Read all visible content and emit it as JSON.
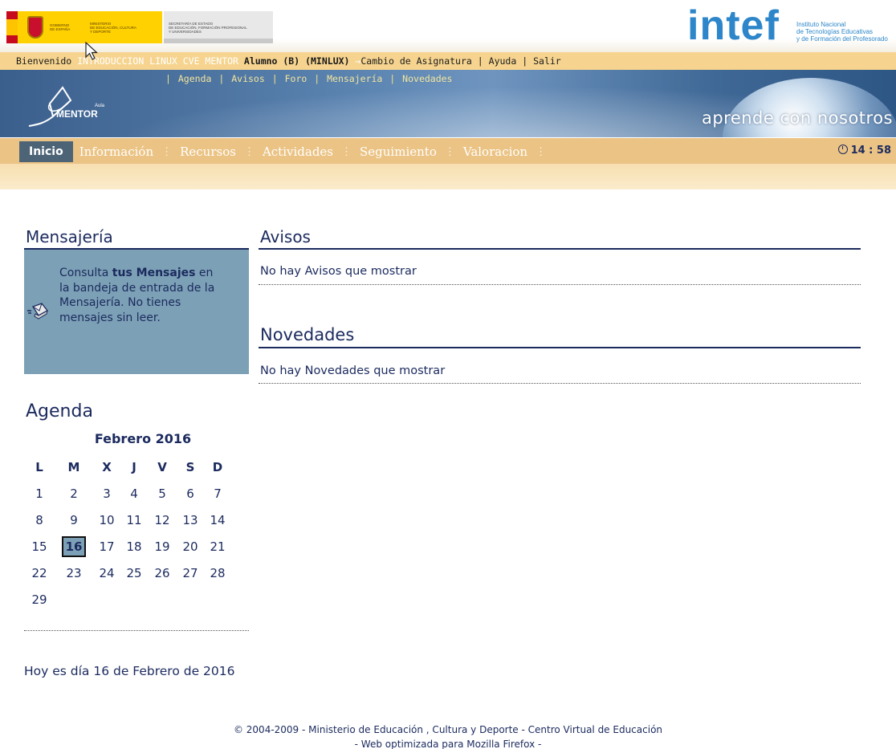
{
  "logos": {
    "gov_line1": "GOBIERNO",
    "gov_line2": "DE ESPAÑA",
    "ministry_line1": "MINISTERIO",
    "ministry_line2": "DE EDUCACIÓN, CULTURA",
    "ministry_line3": "Y DEPORTE",
    "secretary_line1": "SECRETARÍA DE ESTADO",
    "secretary_line2": "DE EDUCACIÓN, FORMACIÓN PROFESIONAL",
    "secretary_line3": "Y UNIVERSIDADES",
    "intef": "intef",
    "intef_sub1": "Instituto Nacional",
    "intef_sub2": "de Tecnologías Educativas",
    "intef_sub3": "y de Formación del Profesorado"
  },
  "user_bar": {
    "welcome": "Bienvenido",
    "course": "INTRODUCCION LINUX CVE MENTOR",
    "student": "Alumno (B) (MINLUX)",
    "arrow": "→",
    "change_subject": "Cambio de Asignatura",
    "help": "Ayuda",
    "exit": "Salir",
    "sep": "|"
  },
  "banner": {
    "links": [
      "Agenda",
      "Avisos",
      "Foro",
      "Mensajería",
      "Novedades"
    ],
    "sep": "|",
    "mentor": "MENTOR",
    "aula": "Aula",
    "slogan": "aprende con nosotros"
  },
  "main_nav": {
    "tabs": [
      "Inicio",
      "Información",
      "Recursos",
      "Actividades",
      "Seguimiento",
      "Valoracion"
    ],
    "active_index": 0,
    "sep": "⋮",
    "clock": "14 : 58"
  },
  "mensajeria": {
    "title": "Mensajería",
    "text_pre": "Consulta ",
    "text_bold": "tus Mensajes",
    "text_post": " en la bandeja de entrada de la Mensajería. No tienes mensajes sin leer."
  },
  "agenda": {
    "title": "Agenda",
    "month": "Febrero 2016",
    "weekdays": [
      "L",
      "M",
      "X",
      "J",
      "V",
      "S",
      "D"
    ],
    "weeks": [
      [
        "1",
        "2",
        "3",
        "4",
        "5",
        "6",
        "7"
      ],
      [
        "8",
        "9",
        "10",
        "11",
        "12",
        "13",
        "14"
      ],
      [
        "15",
        "16",
        "17",
        "18",
        "19",
        "20",
        "21"
      ],
      [
        "22",
        "23",
        "24",
        "25",
        "26",
        "27",
        "28"
      ],
      [
        "29",
        "",
        "",
        "",
        "",
        "",
        ""
      ]
    ],
    "today": "16",
    "today_text": "Hoy es día 16 de Febrero de 2016"
  },
  "avisos": {
    "title": "Avisos",
    "empty": "No hay Avisos que mostrar"
  },
  "novedades": {
    "title": "Novedades",
    "empty": "No hay Novedades que mostrar"
  },
  "footer": {
    "line1": "© 2004-2009 - Ministerio de Educación , Cultura y Deporte - Centro Virtual de Educación",
    "line2": "- Web optimizada para Mozilla Firefox -"
  },
  "colors": {
    "navy": "#1b2a5e",
    "panel_blue": "#7ca0b5",
    "user_bar": "#f6d48f",
    "main_nav": "#ebc384",
    "active_tab": "#4d6477",
    "intef_blue": "#2c86c9"
  }
}
